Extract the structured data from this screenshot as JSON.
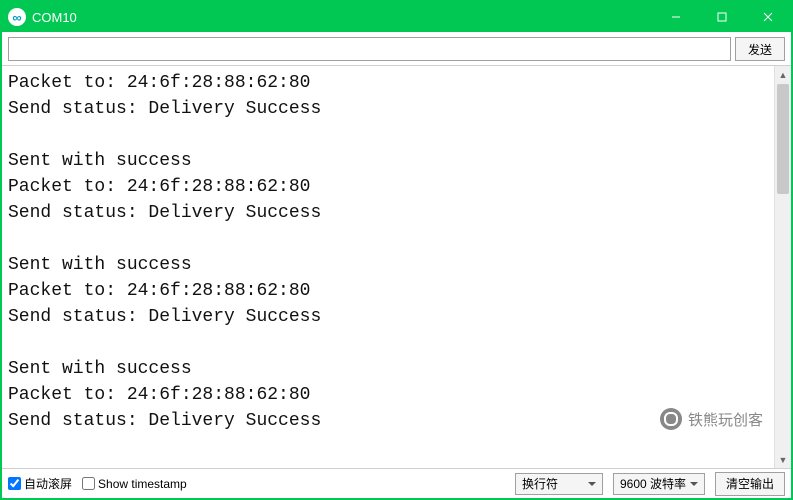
{
  "window": {
    "title": "COM10"
  },
  "input": {
    "value": "",
    "placeholder": ""
  },
  "buttons": {
    "send": "发送",
    "clear": "清空输出"
  },
  "console": {
    "lines": [
      "Packet to: 24:6f:28:88:62:80",
      "Send status: Delivery Success",
      "",
      "Sent with success",
      "Packet to: 24:6f:28:88:62:80",
      "Send status: Delivery Success",
      "",
      "Sent with success",
      "Packet to: 24:6f:28:88:62:80",
      "Send status: Delivery Success",
      "",
      "Sent with success",
      "Packet to: 24:6f:28:88:62:80",
      "Send status: Delivery Success"
    ]
  },
  "footer": {
    "autoscroll_label": "自动滚屏",
    "autoscroll_checked": true,
    "timestamp_label": "Show timestamp",
    "timestamp_checked": false,
    "line_ending_selected": "换行符",
    "baud_selected": "9600 波特率"
  },
  "watermark": {
    "text": "铁熊玩创客"
  }
}
